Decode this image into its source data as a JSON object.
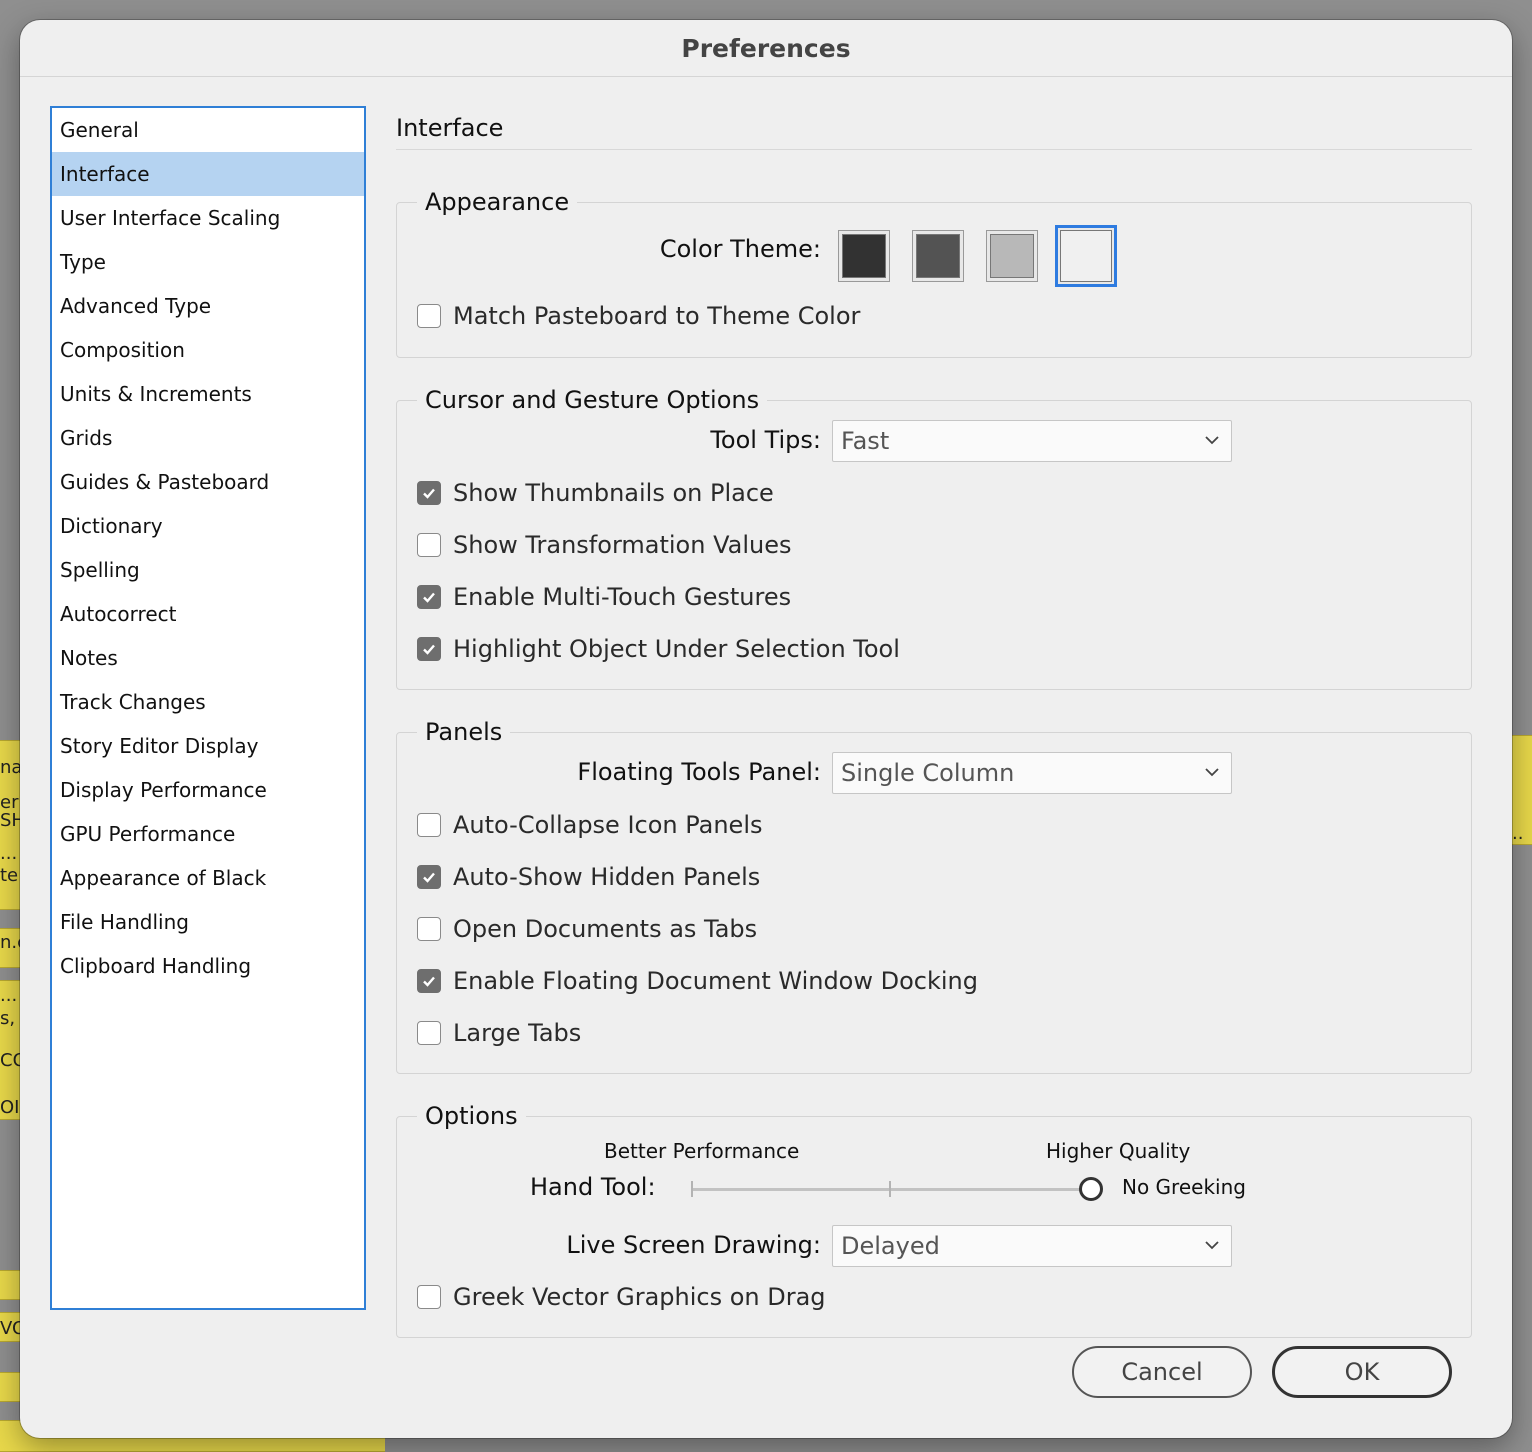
{
  "window": {
    "title": "Preferences"
  },
  "background_snippets": [
    "nas",
    "er",
    "SH",
    "...",
    "te:",
    "n.c",
    "...",
    "s, e",
    "CO",
    "OI",
    "VO",
    ".."
  ],
  "sidebar": {
    "items": [
      {
        "label": "General",
        "selected": false
      },
      {
        "label": "Interface",
        "selected": true
      },
      {
        "label": "User Interface Scaling",
        "selected": false
      },
      {
        "label": "Type",
        "selected": false
      },
      {
        "label": "Advanced Type",
        "selected": false
      },
      {
        "label": "Composition",
        "selected": false
      },
      {
        "label": "Units & Increments",
        "selected": false
      },
      {
        "label": "Grids",
        "selected": false
      },
      {
        "label": "Guides & Pasteboard",
        "selected": false
      },
      {
        "label": "Dictionary",
        "selected": false
      },
      {
        "label": "Spelling",
        "selected": false
      },
      {
        "label": "Autocorrect",
        "selected": false
      },
      {
        "label": "Notes",
        "selected": false
      },
      {
        "label": "Track Changes",
        "selected": false
      },
      {
        "label": "Story Editor Display",
        "selected": false
      },
      {
        "label": "Display Performance",
        "selected": false
      },
      {
        "label": "GPU Performance",
        "selected": false
      },
      {
        "label": "Appearance of Black",
        "selected": false
      },
      {
        "label": "File Handling",
        "selected": false
      },
      {
        "label": "Clipboard Handling",
        "selected": false
      }
    ]
  },
  "main": {
    "section_title": "Interface",
    "appearance": {
      "legend": "Appearance",
      "color_theme_label": "Color Theme:",
      "themes": [
        {
          "color": "#323232",
          "selected": false
        },
        {
          "color": "#535353",
          "selected": false
        },
        {
          "color": "#b8b8b8",
          "selected": false
        },
        {
          "color": "#f0f0f0",
          "selected": true
        }
      ],
      "match_pasteboard": {
        "label": "Match Pasteboard to Theme Color",
        "checked": false
      }
    },
    "cursor": {
      "legend": "Cursor and Gesture Options",
      "tool_tips_label": "Tool Tips:",
      "tool_tips_value": "Fast",
      "checks": [
        {
          "label": "Show Thumbnails on Place",
          "checked": true
        },
        {
          "label": "Show Transformation Values",
          "checked": false
        },
        {
          "label": "Enable Multi-Touch Gestures",
          "checked": true
        },
        {
          "label": "Highlight Object Under Selection Tool",
          "checked": true
        }
      ]
    },
    "panels": {
      "legend": "Panels",
      "floating_label": "Floating Tools Panel:",
      "floating_value": "Single Column",
      "checks": [
        {
          "label": "Auto-Collapse Icon Panels",
          "checked": false
        },
        {
          "label": "Auto-Show Hidden Panels",
          "checked": true
        },
        {
          "label": "Open Documents as Tabs",
          "checked": false
        },
        {
          "label": "Enable Floating Document Window Docking",
          "checked": true
        },
        {
          "label": "Large Tabs",
          "checked": false
        }
      ]
    },
    "options": {
      "legend": "Options",
      "better_performance": "Better Performance",
      "higher_quality": "Higher Quality",
      "hand_tool_label": "Hand Tool:",
      "hand_tool_value": "No Greeking",
      "hand_tool_position": 1.0,
      "live_drawing_label": "Live Screen Drawing:",
      "live_drawing_value": "Delayed",
      "greek_vector": {
        "label": "Greek Vector Graphics on Drag",
        "checked": false
      }
    }
  },
  "buttons": {
    "cancel": "Cancel",
    "ok": "OK"
  },
  "colors": {
    "accent": "#2e7be0",
    "selected_row": "#b5d3f1",
    "window_bg": "#efefef"
  }
}
